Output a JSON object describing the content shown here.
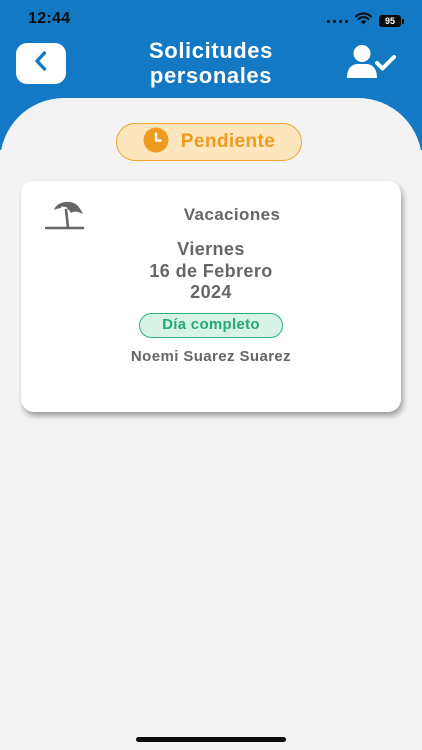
{
  "status_bar": {
    "time": "12:44",
    "battery": "95"
  },
  "header": {
    "title_line1": "Solicitudes",
    "title_line2": "personales",
    "back_icon": "chevron-left-icon",
    "action_icon": "user-check-icon"
  },
  "filter": {
    "status_label": "Pendiente",
    "status_icon": "clock-icon"
  },
  "request": {
    "icon": "beach-umbrella-icon",
    "type": "Vacaciones",
    "weekday": "Viernes",
    "date": "16 de Febrero",
    "year": "2024",
    "duration": "Día completo",
    "employee": "Noemi Suarez Suarez"
  },
  "colors": {
    "header_blue": "#1479c4",
    "pending_orange": "#ee9b1f",
    "pending_bg": "#fde6bd",
    "full_day_green": "#28a777",
    "full_day_bg": "#d7f2e7",
    "background": "#f3f3f3"
  }
}
